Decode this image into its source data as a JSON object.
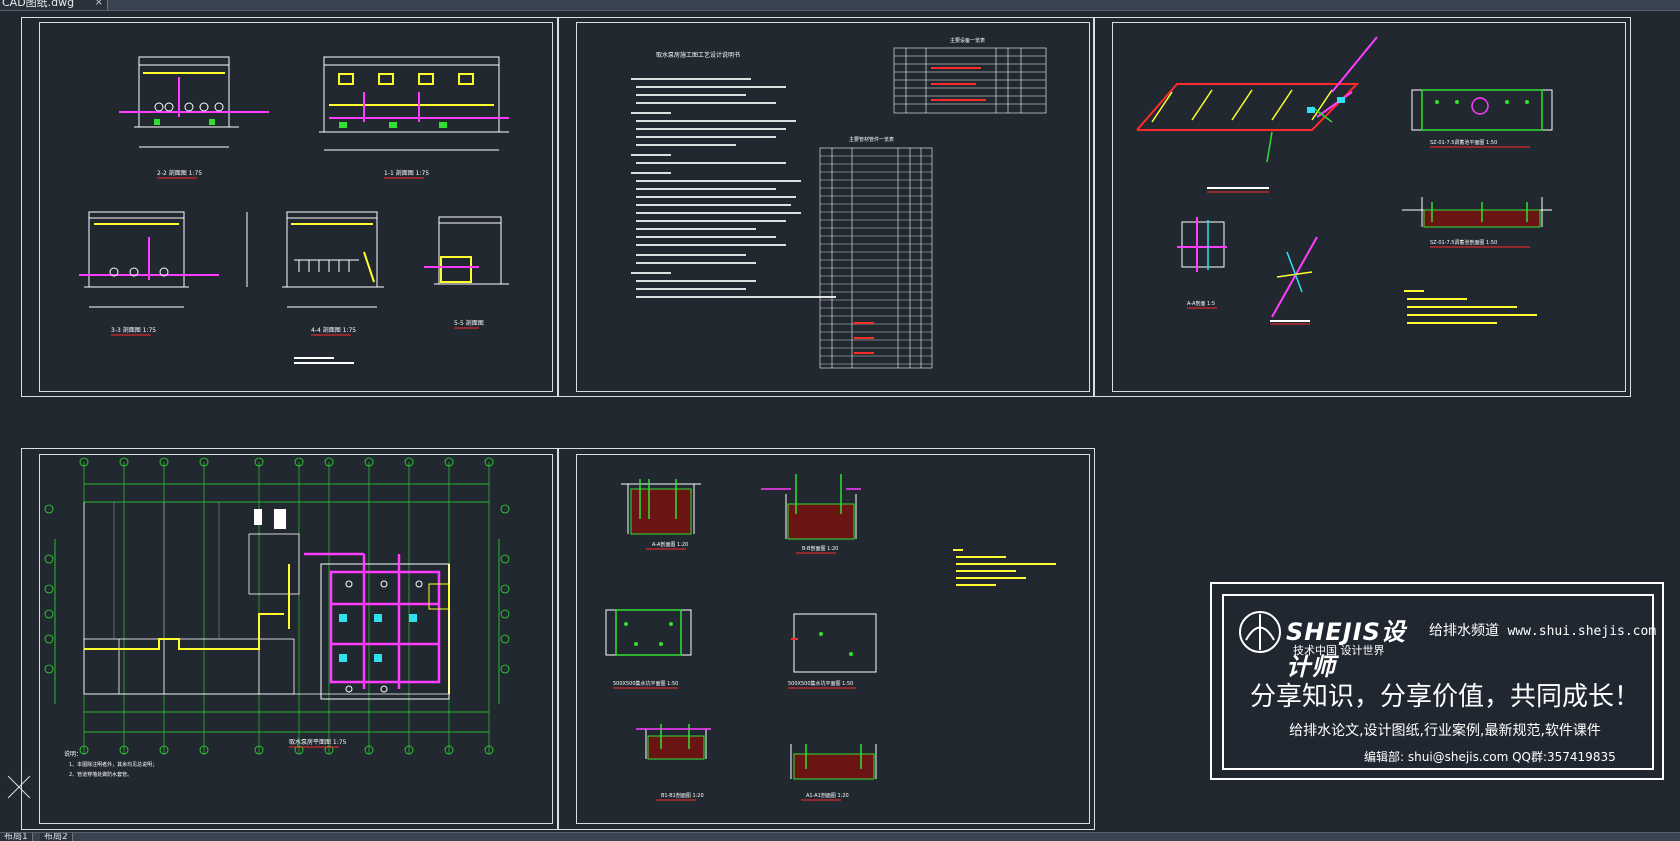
{
  "window": {
    "file_tab": "CAD图纸.dwg",
    "file_tab_close": "×"
  },
  "layout_tabs": [
    "布局1",
    "布局2"
  ],
  "sheets": {
    "sheet1": {
      "sections": [
        "2-2 剖面图 1:75",
        "1-1 剖面图 1:75",
        "3-3 剖面图 1:75",
        "4-4 剖面图 1:75",
        "5-5 剖面图"
      ]
    },
    "sheet2": {
      "title": "取水泵房施工图工艺设计说明书",
      "table1_title": "主要设备一览表",
      "table2_title": "主要管材管件一览表"
    },
    "sheet3": {
      "section_a": "A-A剖面 1:5",
      "section_sz1": "SZ-01-7.5调蓄池平面图 1:50",
      "section_sz2": "SZ-01-7.5调蓄池剖面图 1:50"
    },
    "sheet4": {
      "title": "取水泵房平面图 1:75",
      "notes_title": "说明：",
      "notes": [
        "1、本图除注明者外，其余均见总说明；",
        "2、管道穿墙处做防水套管。"
      ]
    },
    "sheet5": {
      "sections": [
        "A-A剖面图 1:20",
        "B-B剖面图 1:20",
        "500X500集水坑平面图 1:50",
        "500X500集水坑平面图 1:50",
        "B1-B1剖面图 1:20",
        "A1-A1剖面图 1:20"
      ]
    }
  },
  "stamp": {
    "logo_text": "SHEJIS设计师",
    "logo_sub": "技术中国  设计世界",
    "channel_label": "给排水频道",
    "channel_url": "www.shui.shejis.com",
    "slogan": "分享知识，分享价值，共同成长！",
    "topics": "给排水论文,设计图纸,行业案例,最新规范,软件课件",
    "contact": "编辑部: shui@shejis.com   QQ群:357419835"
  },
  "colors": {
    "background": "#212830",
    "frame": "#d8dee6",
    "pipe_magenta": "#ff3cff",
    "yellow": "#ffff30",
    "green": "#30e030",
    "cyan": "#30e0f0",
    "red": "#ff2a2a"
  }
}
